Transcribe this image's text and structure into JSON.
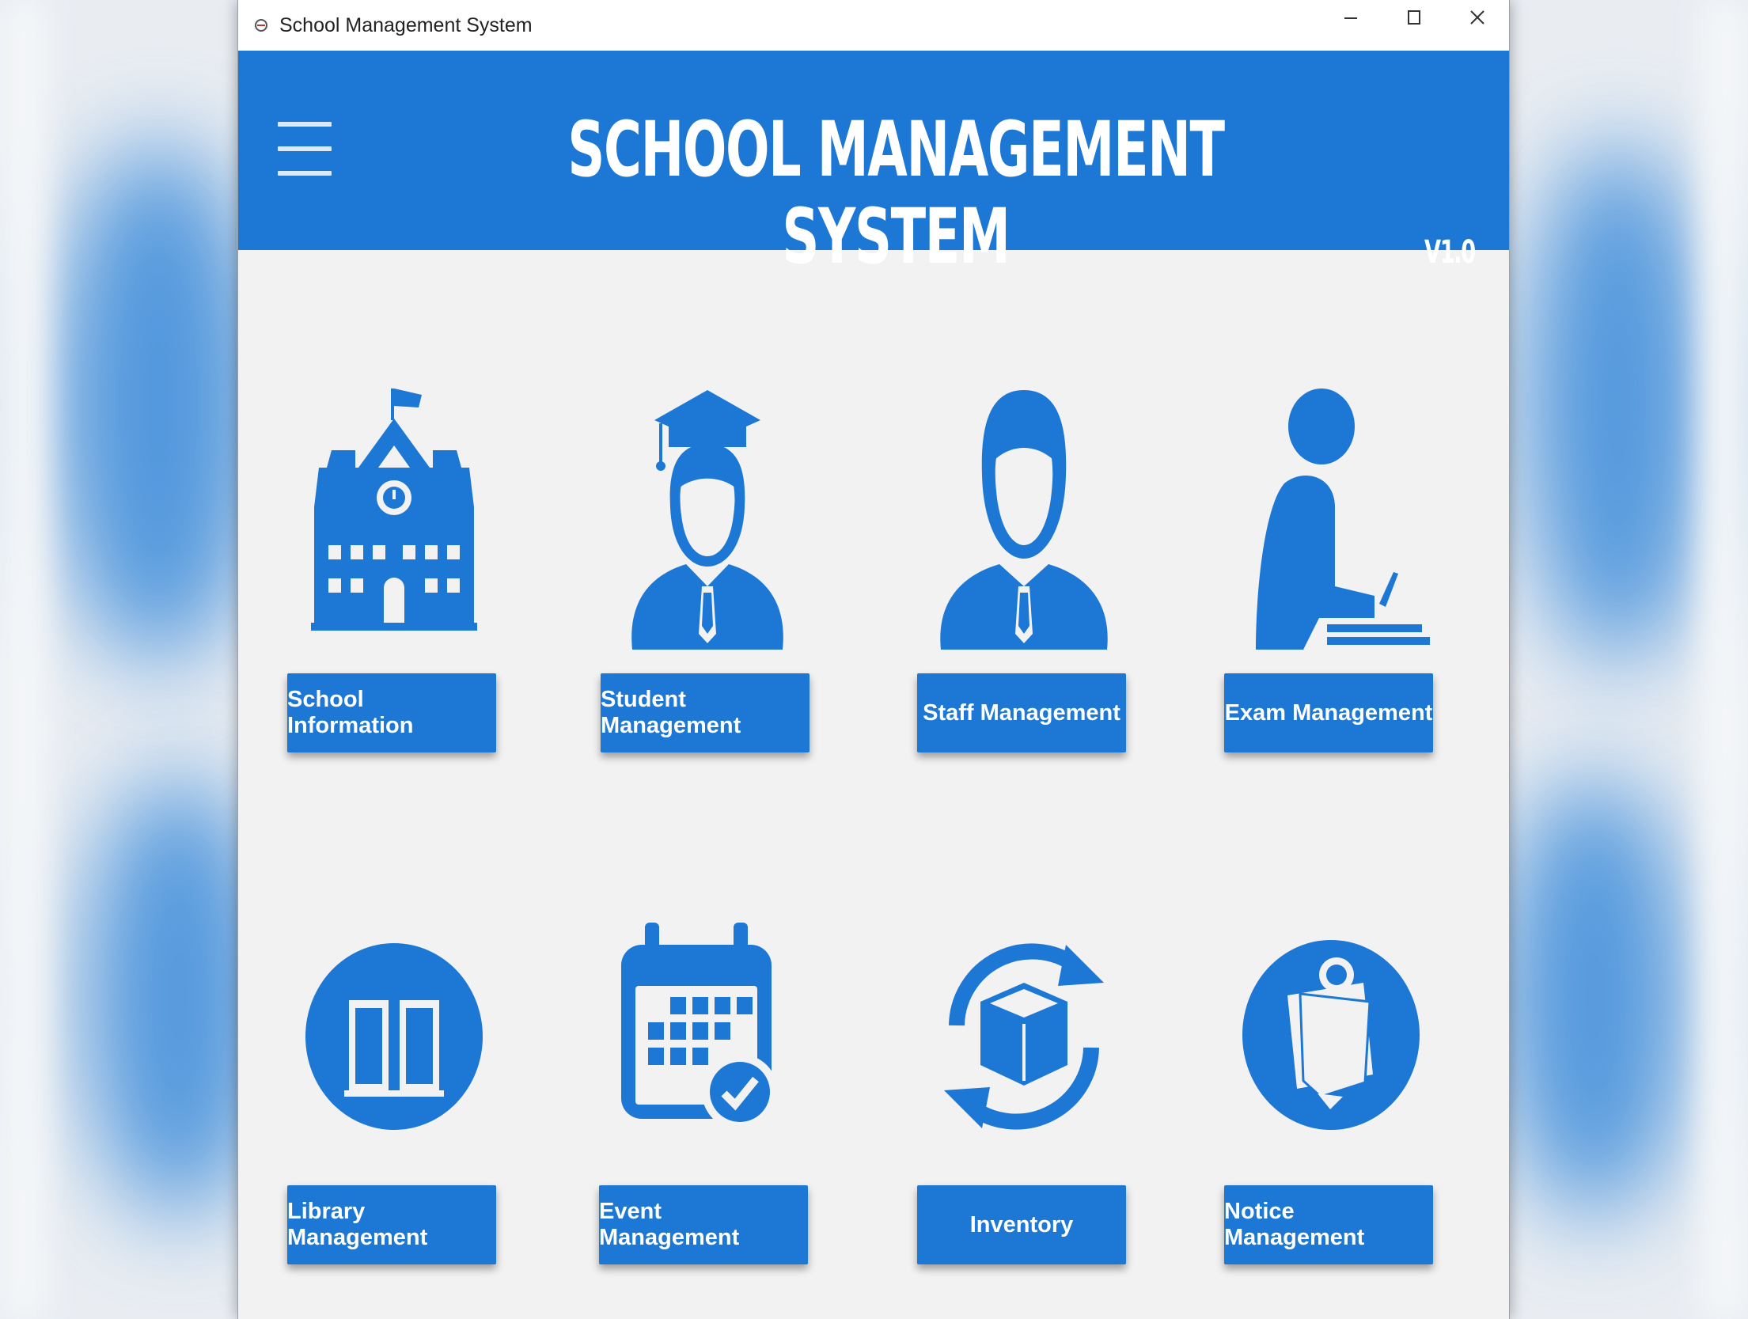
{
  "window": {
    "title": "School Management System"
  },
  "header": {
    "title": "SCHOOL MANAGEMENT SYSTEM",
    "version": "V1.0"
  },
  "modules": [
    {
      "label": "School Information",
      "icon": "school-building-icon"
    },
    {
      "label": "Student Management",
      "icon": "graduate-student-icon"
    },
    {
      "label": "Staff Management",
      "icon": "staff-person-icon"
    },
    {
      "label": "Exam Management",
      "icon": "exam-writing-icon"
    },
    {
      "label": "Library Management",
      "icon": "book-icon"
    },
    {
      "label": "Event Management",
      "icon": "calendar-check-icon"
    },
    {
      "label": "Inventory",
      "icon": "box-refresh-icon"
    },
    {
      "label": "Notice Management",
      "icon": "notice-pin-icon"
    }
  ],
  "colors": {
    "accent": "#1c78d4",
    "background": "#f2f2f2",
    "header_text": "#ffffff"
  }
}
